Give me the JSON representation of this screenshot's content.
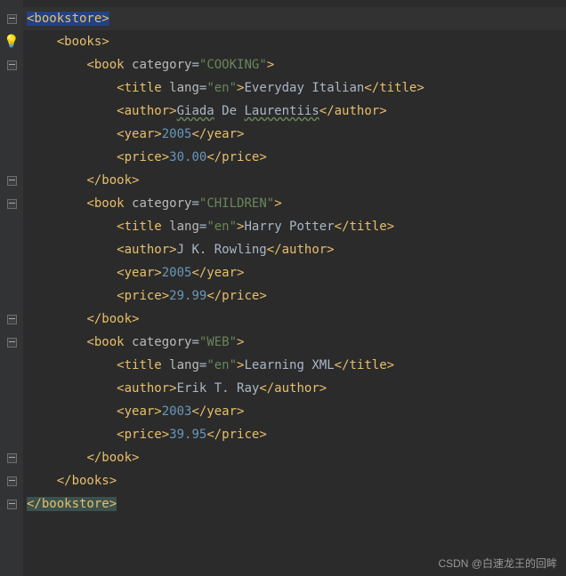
{
  "root_tag": "bookstore",
  "container_tag": "books",
  "books": [
    {
      "category": "COOKING",
      "title_lang": "en",
      "title": "Everyday Italian",
      "author": "Giada De Laurentiis",
      "year": "2005",
      "price": "30.00"
    },
    {
      "category": "CHILDREN",
      "title_lang": "en",
      "title": "Harry Potter",
      "author": "J K. Rowling",
      "year": "2005",
      "price": "29.99"
    },
    {
      "category": "WEB",
      "title_lang": "en",
      "title": "Learning XML",
      "author": "Erik T. Ray",
      "year": "2003",
      "price": "39.95"
    }
  ],
  "watermark": "CSDN @白速龙王的回眸",
  "chart_data": {
    "type": "table",
    "title": "bookstore XML data",
    "columns": [
      "category",
      "title",
      "lang",
      "author",
      "year",
      "price"
    ],
    "rows": [
      [
        "COOKING",
        "Everyday Italian",
        "en",
        "Giada De Laurentiis",
        2005,
        30.0
      ],
      [
        "CHILDREN",
        "Harry Potter",
        "en",
        "J K. Rowling",
        2005,
        29.99
      ],
      [
        "WEB",
        "Learning XML",
        "en",
        "Erik T. Ray",
        2003,
        39.95
      ]
    ]
  }
}
